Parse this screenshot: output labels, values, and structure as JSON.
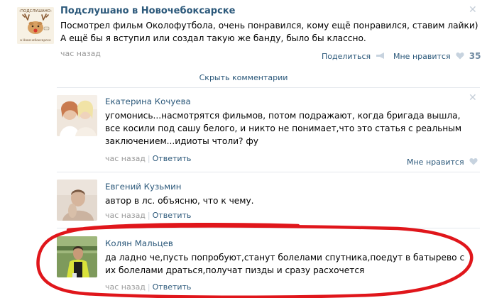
{
  "post": {
    "group_name": "Подслушано в Новочебоксарске",
    "avatar_text_top": "-ПОДСЛУШАНО-",
    "avatar_text_bottom": "в Новочебоксарске",
    "text": "Посмотрел фильм Околофутбола, очень понравился, кому ещё понравился, ставим лайки) А ещё бы я вступил или создал такую же банду, было бы классно.",
    "time": "час назад",
    "share_label": "Поделиться",
    "like_label": "Мне нравится",
    "like_count": "35"
  },
  "hide_comments_label": "Скрыть комментарии",
  "comments": [
    {
      "author": "Екатерина Кочуева",
      "text": "угомонись...насмотрятся фильмов, потом подражают, когда бригада вышла, все косили под сашу белого, и никто не понимает,что это статья с реальным заключением...идиоты чтоли? фу",
      "time": "час назад",
      "reply_label": "Ответить",
      "like_label": "Мне нравится"
    },
    {
      "author": "Евгений Кузьмин",
      "text": "автор в лс. объясню, что к чему.",
      "time": "час назад",
      "reply_label": "Ответить"
    },
    {
      "author": "Колян Мальцев",
      "text": "да ладно че,пусть попробуют,станут болелами спутника,поедут в батырево с их болелами драться,получат пизды и сразу расхочется",
      "time": "час назад",
      "reply_label": "Ответить"
    }
  ],
  "icons": {
    "close": "close-icon",
    "share": "megaphone-icon",
    "like": "heart-icon"
  },
  "colors": {
    "link": "#2b587a",
    "muted": "#999999",
    "annotation": "#e0161b"
  }
}
